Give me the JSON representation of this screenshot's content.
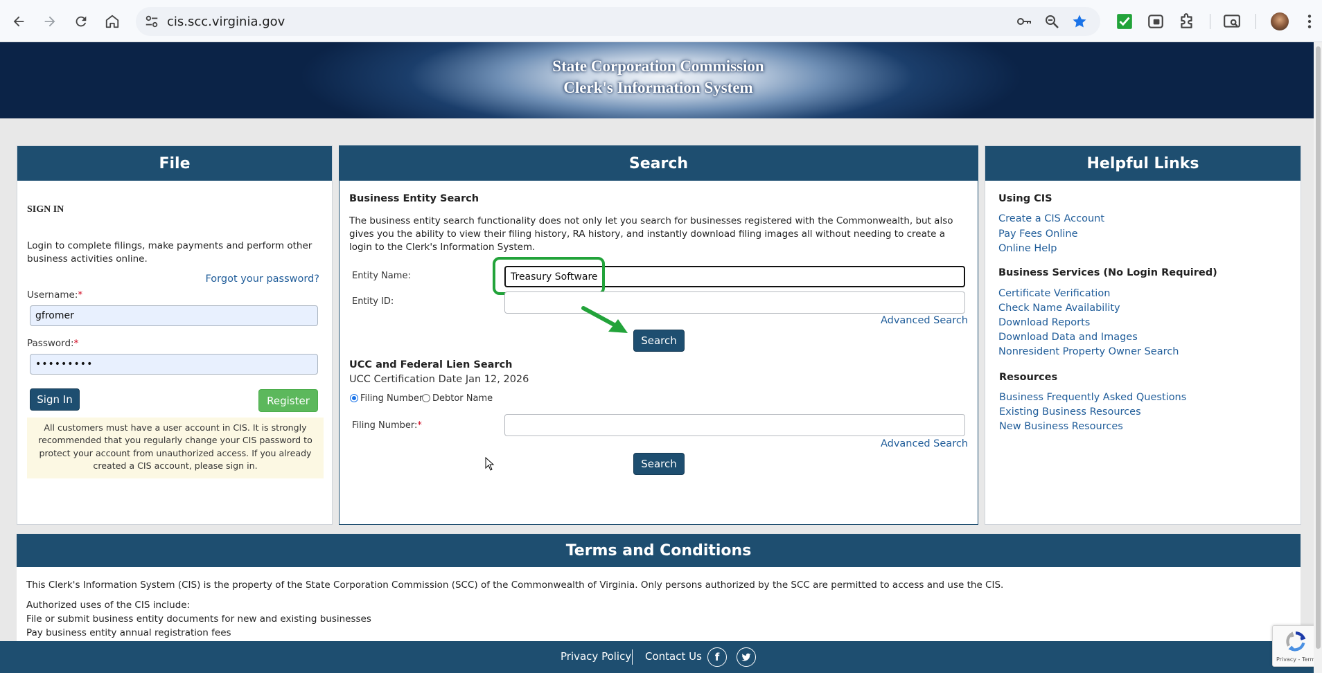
{
  "browser": {
    "url": "cis.scc.virginia.gov",
    "icons": [
      "back-icon",
      "forward-icon",
      "reload-icon",
      "home-icon",
      "site-info-icon",
      "key-icon",
      "zoom-icon",
      "bookmark-star-icon",
      "checkmark-extension-icon",
      "extension-icon",
      "puzzle-icon",
      "tab-search-icon",
      "profile-avatar",
      "menu-icon"
    ]
  },
  "banner": {
    "line1": "State Corporation Commission",
    "line2": "Clerk's Information System"
  },
  "file_panel": {
    "title": "File",
    "sign_in_heading": "SIGN IN",
    "intro": "Login to complete filings, make payments and perform other business activities online.",
    "forgot_password": "Forgot your password?",
    "username_label": "Username:",
    "username_value": "gfromer",
    "password_label": "Password:",
    "password_value": "•••••••••",
    "sign_in_button": "Sign In",
    "register_button": "Register",
    "notice": "All customers must have a user account in CIS. It is strongly recommended that you regularly change your CIS password to protect your account from unauthorized access. If you already created a CIS account, please sign in.",
    "required_marker": "*"
  },
  "search_panel": {
    "title": "Search",
    "business_heading": "Business Entity Search",
    "business_desc": "The business entity search functionality does not only let you search for businesses registered with the Commonwealth, but also gives you the ability to view their filing history, RA history, and instantly download filing images all without needing to create a login to the Clerk's Information System.",
    "entity_name_label": "Entity Name:",
    "entity_name_value": "Treasury Software",
    "entity_id_label": "Entity ID:",
    "entity_id_value": "",
    "advanced_search": "Advanced Search",
    "search_button": "Search",
    "ucc_heading": "UCC and Federal Lien Search",
    "ucc_cert_date": "UCC Certification Date Jan 12, 2026",
    "radio_filing_number": "Filing Number",
    "radio_debtor_name": "Debtor Name",
    "filing_number_label": "Filing Number:",
    "filing_number_value": "",
    "advanced_search_2": "Advanced Search",
    "search_button_2": "Search",
    "required_marker": "*"
  },
  "links_panel": {
    "title": "Helpful Links",
    "sections": [
      {
        "heading": "Using CIS",
        "links": [
          "Create a CIS Account",
          "Pay Fees Online",
          "Online Help"
        ]
      },
      {
        "heading": "Business Services (No Login Required)",
        "links": [
          "Certificate Verification",
          "Check Name Availability",
          "Download Reports",
          "Download Data and Images",
          "Nonresident Property Owner Search"
        ]
      },
      {
        "heading": "Resources",
        "links": [
          "Business Frequently Asked Questions",
          "Existing Business Resources",
          "New Business Resources"
        ]
      }
    ]
  },
  "terms": {
    "title": "Terms and Conditions",
    "para1": "This Clerk's Information System (CIS) is the property of the State Corporation Commission (SCC) of the Commonwealth of Virginia. Only persons authorized by the SCC are permitted to access and use the CIS.",
    "authorized_heading": "Authorized uses of the CIS include:",
    "use1": "File or submit business entity documents for new and existing businesses",
    "use2": "Pay business entity annual registration fees"
  },
  "footer": {
    "privacy": "Privacy Policy",
    "contact": "Contact Us",
    "facebook": "f",
    "twitter_icon": "twitter-icon"
  },
  "recaptcha": {
    "text": "Privacy - Terms"
  },
  "colors": {
    "navy": "#1e4e70",
    "link": "#1f5c99",
    "green_highlight": "#22a33a",
    "register_green": "#5cb85c",
    "notice_bg": "#fcf8e3"
  }
}
